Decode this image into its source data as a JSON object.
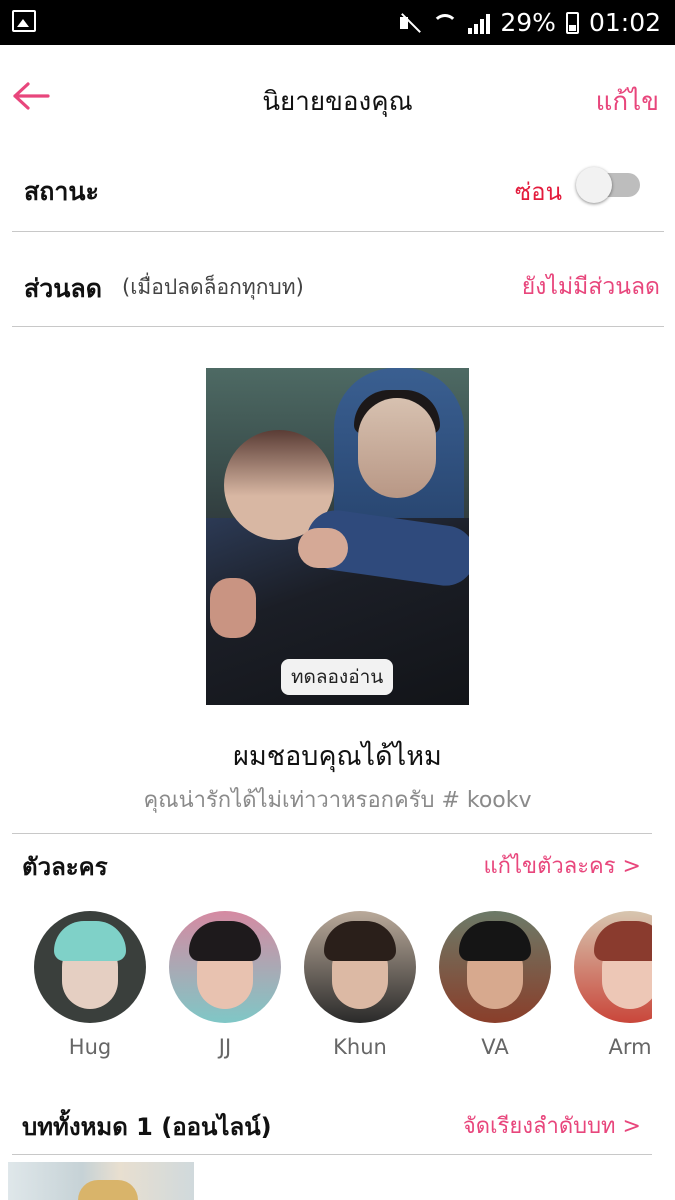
{
  "status_bar": {
    "battery": "29%",
    "time": "01:02",
    "icons": [
      "gallery-icon",
      "mute-icon",
      "wifi-icon",
      "signal-icon",
      "battery-icon"
    ]
  },
  "header": {
    "title": "นิยายของคุณ",
    "edit_label": "แก้ไข",
    "back_icon": "arrow-left-icon"
  },
  "status_row": {
    "label": "สถานะ",
    "value": "ซ่อน",
    "toggle_on": false
  },
  "discount_row": {
    "label": "ส่วนลด",
    "note": "(เมื่อปลดล็อกทุกบท)",
    "value": "ยังไม่มีส่วนลด"
  },
  "story": {
    "trial_label": "ทดลองอ่าน",
    "title": "ผมชอบคุณได้ไหม",
    "tagline": "คุณน่ารักได้ไม่เท่าวาหรอกครับ # kookv"
  },
  "characters": {
    "title": "ตัวละคร",
    "edit_link": "แก้ไขตัวละคร >",
    "items": [
      {
        "name": "Hug"
      },
      {
        "name": "JJ"
      },
      {
        "name": "Khun"
      },
      {
        "name": "VA"
      },
      {
        "name": "Arm"
      }
    ]
  },
  "chapters": {
    "title": "บททั้งหมด 1 (ออนไลน์)",
    "sort_link": "จัดเรียงลำดับบท >"
  },
  "colors": {
    "accent": "#e8467c",
    "status_red": "#e31c3d",
    "divider": "#c8c8c8"
  }
}
